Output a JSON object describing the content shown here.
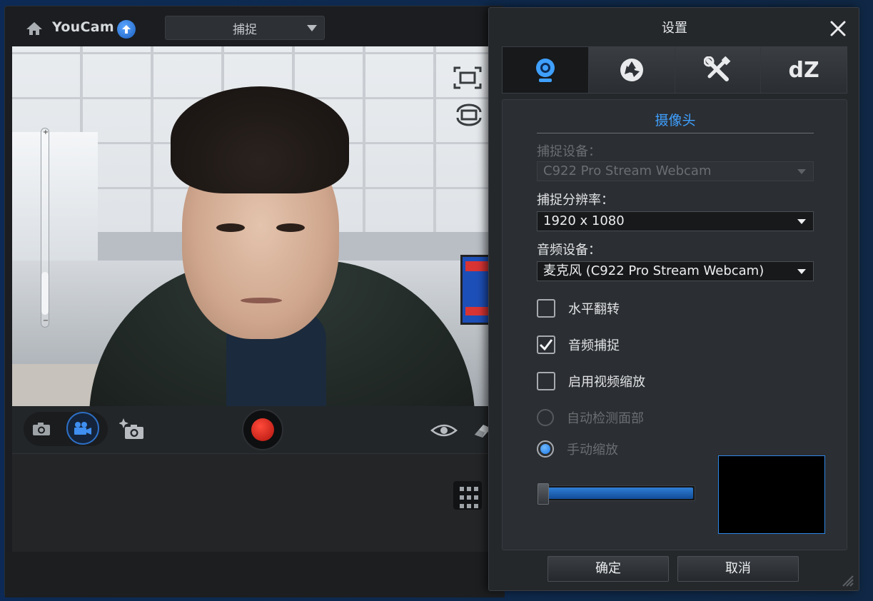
{
  "main": {
    "app_title": "YouCam",
    "mode_select": "捕捉"
  },
  "settings": {
    "title": "设置",
    "tabs": [
      {
        "icon": "webcam-icon",
        "active": true
      },
      {
        "icon": "aperture-icon",
        "active": false
      },
      {
        "icon": "tools-icon",
        "active": false
      },
      {
        "icon": "dz-logo",
        "label": "dZ",
        "active": false
      }
    ],
    "section_title": "摄像头",
    "capture_device_label": "捕捉设备：",
    "capture_device_value": "C922 Pro Stream Webcam",
    "resolution_label": "捕捉分辨率：",
    "resolution_value": "1920 x 1080",
    "audio_device_label": "音频设备：",
    "audio_device_value": "麦克风 (C922 Pro Stream Webcam)",
    "horizontal_flip_label": "水平翻转",
    "horizontal_flip_checked": false,
    "audio_capture_label": "音频捕捉",
    "audio_capture_checked": true,
    "video_zoom_label": "启用视频缩放",
    "video_zoom_checked": false,
    "auto_detect_face_label": "自动检测面部",
    "manual_zoom_label": "手动缩放",
    "manual_zoom_selected": true,
    "zoom_level": 1.0,
    "ok_label": "确定",
    "cancel_label": "取消"
  },
  "colors": {
    "accent": "#3fa0ff",
    "record": "#d01e16"
  }
}
